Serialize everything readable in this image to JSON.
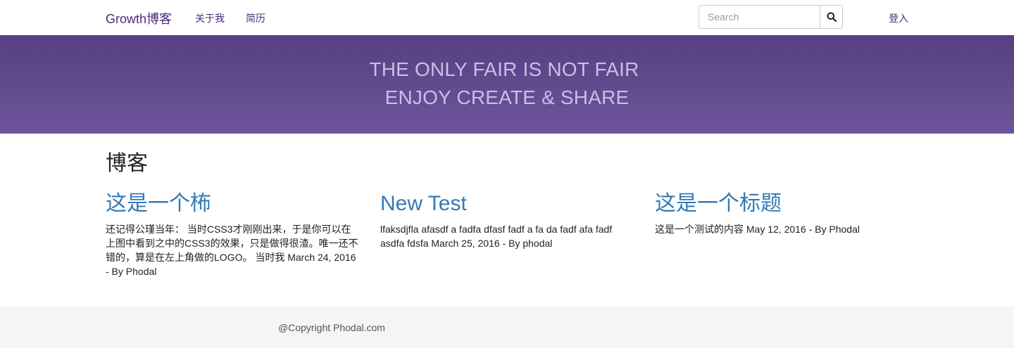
{
  "navbar": {
    "brand": "Growth博客",
    "links": [
      {
        "label": "关于我"
      },
      {
        "label": "简历"
      }
    ],
    "search": {
      "placeholder": "Search",
      "value": ""
    },
    "login": "登入"
  },
  "hero": {
    "line1": "THE ONLY FAIR IS NOT FAIR",
    "line2": "ENJOY CREATE & SHARE"
  },
  "blog": {
    "title": "博客",
    "posts": [
      {
        "title": "这是一个柨",
        "excerpt": "还记得公瑾当年： 当时CSS3才刚刚出来，于是你可以在上图中看到之中的CSS3的效果，只是做得很渣。唯一还不错的，算是在左上角做的LOGO。 当时我 March 24, 2016 - By Phodal"
      },
      {
        "title": "New Test",
        "excerpt": "lfaksdjfla afasdf a fadfa dfasf fadf a fa da fadf afa fadf asdfa fdsfa March 25, 2016 - By phodal"
      },
      {
        "title": "这是一个标题",
        "excerpt": "这是一个测试的内容 May 12, 2016 - By Phodal"
      }
    ]
  },
  "footer": {
    "copyright": "@Copyright Phodal.com"
  },
  "colors": {
    "brand": "#4b2c7a",
    "hero_top": "#563f82",
    "hero_bottom": "#6e559b",
    "hero_text": "#cdbde6",
    "link": "#337ab7",
    "footer_bg": "#f5f5f5"
  },
  "icons": {
    "search_button": "search-icon"
  }
}
